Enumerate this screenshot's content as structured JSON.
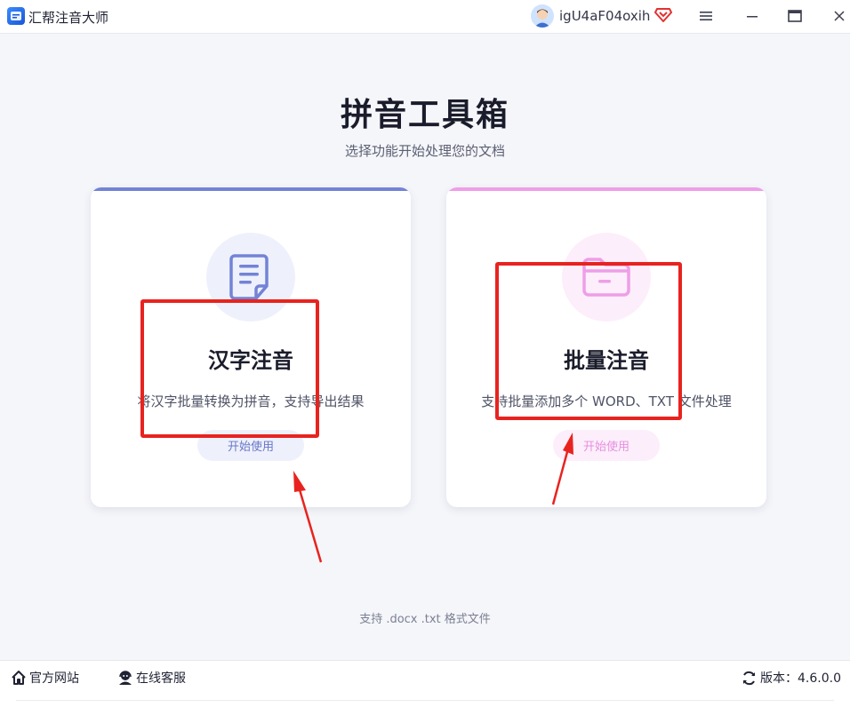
{
  "app": {
    "title": "汇帮注音大师",
    "logo_icon": "app-logo-icon",
    "username": "igU4aF04oxih",
    "vip_icon": "diamond-icon"
  },
  "window_controls": {
    "menu_icon": "hamburger-menu-icon",
    "minimize_icon": "minimize-icon",
    "maximize_icon": "maximize-icon",
    "close_icon": "close-icon"
  },
  "main": {
    "title": "拼音工具箱",
    "subtitle": "选择功能开始处理您的文档",
    "cards": [
      {
        "icon": "document-icon",
        "title": "汉字注音",
        "description": "将汉字批量转换为拼音，支持导出结果",
        "button_label": "开始使用",
        "accent_color": "#7383d6"
      },
      {
        "icon": "folder-icon",
        "title": "批量注音",
        "description": "支持批量添加多个 WORD、TXT 文件处理",
        "button_label": "开始使用",
        "accent_color": "#ee9ee8"
      }
    ],
    "support_text": "支持 .docx .txt 格式文件"
  },
  "footer": {
    "official_site_label": "官方网站",
    "official_site_icon": "home-icon",
    "online_service_label": "在线客服",
    "online_service_icon": "headset-icon",
    "version_icon": "refresh-icon",
    "version_label": "版本：4.6.0.0"
  },
  "annotation_color": "#e8231f"
}
